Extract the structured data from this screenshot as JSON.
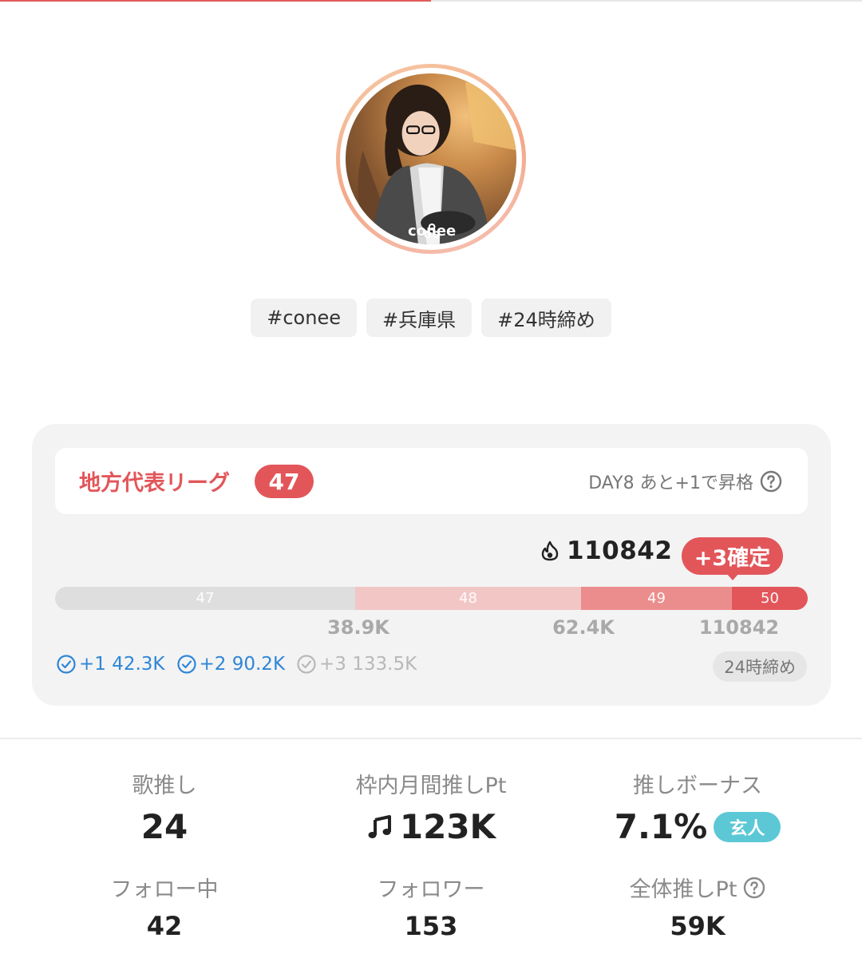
{
  "load_progress": 0.5,
  "avatar": {
    "brand_text": "conee"
  },
  "tags": [
    "#conee",
    "#兵庫県",
    "#24時締め"
  ],
  "league": {
    "name": "地方代表リーグ",
    "rank": "47",
    "status_text": "DAY8 あと+1で昇格",
    "score": "110842",
    "confirm_label": "+3確定",
    "segments": [
      {
        "label": "47",
        "color": "#dedede"
      },
      {
        "label": "48",
        "color": "#f3c6c6"
      },
      {
        "label": "49",
        "color": "#ec8d8d"
      },
      {
        "label": "50",
        "color": "#e2565a"
      }
    ],
    "thresholds": [
      "38.9K",
      "62.4K",
      "110842"
    ],
    "targets": [
      {
        "label": "+1 42.3K",
        "status": "done"
      },
      {
        "label": "+2 90.2K",
        "status": "done"
      },
      {
        "label": "+3 133.5K",
        "status": "pending"
      }
    ],
    "deadline": "24時締め"
  },
  "stats": {
    "song_oshi": {
      "label": "歌推し",
      "value": "24"
    },
    "monthly_pt": {
      "label": "枠内月間推しPt",
      "value": "123K"
    },
    "bonus": {
      "label": "推しボーナス",
      "value": "7.1%",
      "rank": "玄人"
    },
    "following": {
      "label": "フォロー中",
      "value": "42"
    },
    "followers": {
      "label": "フォロワー",
      "value": "153"
    },
    "total_pt": {
      "label": "全体推しPt",
      "value": "59K"
    }
  },
  "colors": {
    "accent": "#e2565a",
    "link_blue": "#2f86d6",
    "rank_teal": "#5cc8d6"
  },
  "icons": [
    "flame-icon",
    "question-icon",
    "check-circle-icon",
    "music-note-icon"
  ]
}
